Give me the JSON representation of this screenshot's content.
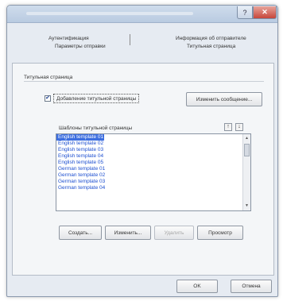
{
  "dialog": {
    "title": ""
  },
  "tabs": [
    {
      "label": "Аутентификация"
    },
    {
      "label": "Параметры отправки"
    },
    {
      "label": "Информация об отправителе"
    },
    {
      "label": "Титульная страница"
    }
  ],
  "cover_page": {
    "group_label": "Титульная страница",
    "add_cover_checked": "✔",
    "add_cover_label": "Добавление титульной страницы",
    "edit_message_button": "Изменить сообщение...",
    "templates_header": "Шаблоны титульной страницы",
    "sort_up_glyph": "↑",
    "sort_down_glyph": "↓",
    "templates": [
      "English template 01",
      "English template 02",
      "English template 03",
      "English template 04",
      "English template 05",
      "German template 01",
      "German template 02",
      "German template 03",
      "German template 04"
    ],
    "selected_index": 0,
    "actions": {
      "create": "Создать...",
      "edit": "Изменить...",
      "delete": "Удалить",
      "preview": "Просмотр"
    }
  },
  "footer": {
    "ok": "OK",
    "cancel": "Отмена"
  },
  "icons": {
    "help": "?",
    "close": "✕"
  }
}
